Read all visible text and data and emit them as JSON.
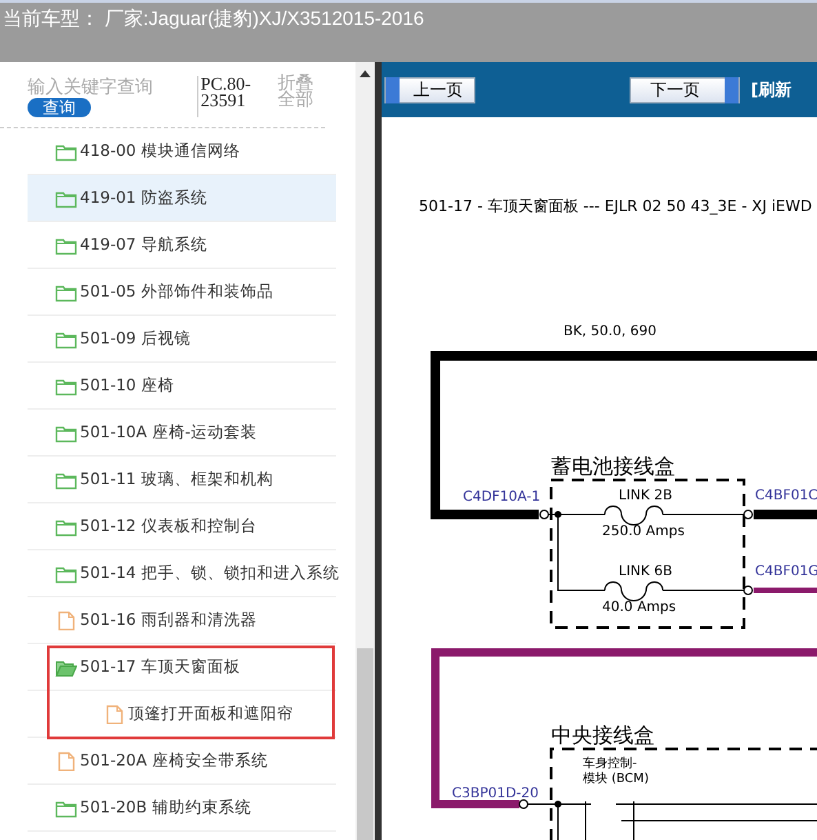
{
  "header": {
    "title": "当前车型： 厂家:Jaguar(捷豹)XJ/X3512015-2016"
  },
  "search": {
    "placeholder": "输入关键字查询",
    "button": "查询",
    "code": "PC.80-23591",
    "collapse": "折叠全部"
  },
  "tree": [
    {
      "kind": "folder",
      "label": "418-00 模块通信网络",
      "selected": false
    },
    {
      "kind": "folder",
      "label": "419-01 防盗系统",
      "selected": true
    },
    {
      "kind": "folder",
      "label": "419-07 导航系统",
      "selected": false
    },
    {
      "kind": "folder",
      "label": "501-05 外部饰件和装饰品",
      "selected": false
    },
    {
      "kind": "folder",
      "label": "501-09 后视镜",
      "selected": false
    },
    {
      "kind": "folder",
      "label": "501-10 座椅",
      "selected": false
    },
    {
      "kind": "folder",
      "label": "501-10A 座椅-运动套装",
      "selected": false
    },
    {
      "kind": "folder",
      "label": "501-11 玻璃、框架和机构",
      "selected": false
    },
    {
      "kind": "folder",
      "label": "501-12 仪表板和控制台",
      "selected": false
    },
    {
      "kind": "folder",
      "label": "501-14 把手、锁、锁扣和进入系统",
      "selected": false
    },
    {
      "kind": "file",
      "label": "501-16 雨刮器和清洗器",
      "selected": false
    },
    {
      "kind": "folder-open",
      "label": "501-17 车顶天窗面板",
      "selected": false,
      "marked": true,
      "children": [
        {
          "kind": "file",
          "label": "顶篷打开面板和遮阳帘",
          "selected": false
        }
      ]
    },
    {
      "kind": "file",
      "label": "501-20A 座椅安全带系统",
      "selected": false
    },
    {
      "kind": "folder",
      "label": "501-20B 辅助约束系统",
      "selected": false
    }
  ],
  "toolbar": {
    "prev": "上一页",
    "next": "下一页",
    "refresh": "[刷新"
  },
  "diagram": {
    "title": "501-17 - 车顶天窗面板 --- EJLR 02 50 43_3E - XJ iEWD",
    "wire_label": "BK, 50.0, 690",
    "battery_box": "蓄电池接线盒",
    "left_connector": "C4DF10A-1",
    "links": [
      {
        "name": "LINK 2B",
        "rating": "250.0 Amps",
        "connector": "C4BF01C"
      },
      {
        "name": "LINK 6B",
        "rating": "40.0 Amps",
        "connector": "C4BF01G"
      }
    ],
    "central_box": "中央接线盒",
    "central_connector": "C3BP01D-20",
    "module": [
      "车身控制-",
      "模块 (BCM)"
    ]
  }
}
